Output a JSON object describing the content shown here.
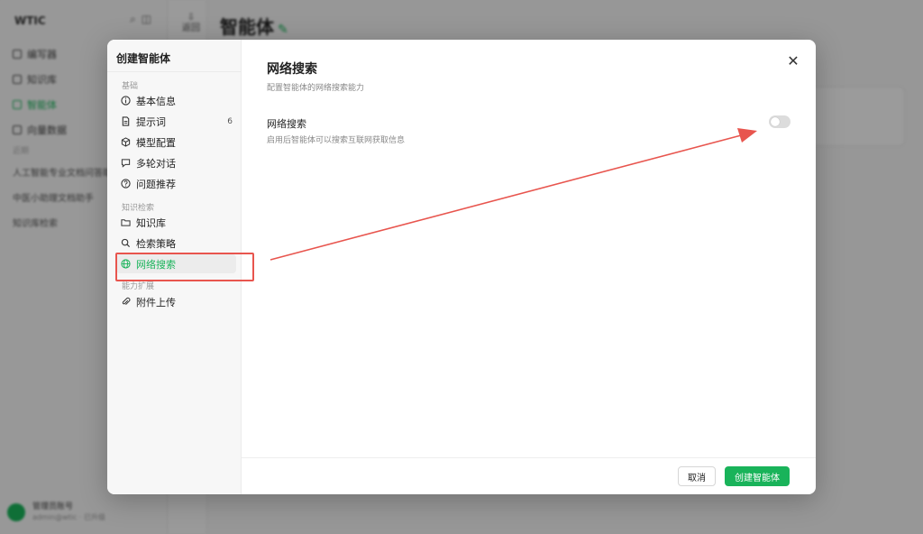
{
  "background": {
    "logo": "WTIC",
    "nav": [
      "编写器",
      "知识库",
      "智能体",
      "向量数据"
    ],
    "active_nav_index": 2,
    "section_label": "近期",
    "list": [
      "人工智能专业文档问答助手",
      "中医小助理文档助手",
      "知识库检索"
    ],
    "user_name": "管理员账号",
    "user_sub": "admin@wtic · 已升级",
    "rail_label": "返回",
    "page_title": "智能体"
  },
  "modal": {
    "sidebar_title": "创建智能体",
    "groups": [
      {
        "label": "基础",
        "items": [
          {
            "label": "基本信息",
            "icon": "info-icon"
          },
          {
            "label": "提示词",
            "icon": "file-icon",
            "badge": "6"
          },
          {
            "label": "模型配置",
            "icon": "cube-icon"
          },
          {
            "label": "多轮对话",
            "icon": "chat-icon"
          },
          {
            "label": "问题推荐",
            "icon": "question-icon"
          }
        ]
      },
      {
        "label": "知识检索",
        "items": [
          {
            "label": "知识库",
            "icon": "folder-icon"
          },
          {
            "label": "检索策略",
            "icon": "search-icon"
          },
          {
            "label": "网络搜索",
            "icon": "globe-icon",
            "active": true
          }
        ]
      },
      {
        "label": "能力扩展",
        "items": [
          {
            "label": "附件上传",
            "icon": "paperclip-icon"
          }
        ]
      }
    ],
    "main": {
      "title": "网络搜索",
      "subtitle": "配置智能体的网络搜索能力",
      "setting_label": "网络搜索",
      "setting_desc": "启用后智能体可以搜索互联网获取信息",
      "toggle_on": false
    },
    "footer": {
      "cancel": "取消",
      "create": "创建智能体"
    }
  },
  "colors": {
    "accent": "#19b35a",
    "annotation": "#e8554e"
  }
}
